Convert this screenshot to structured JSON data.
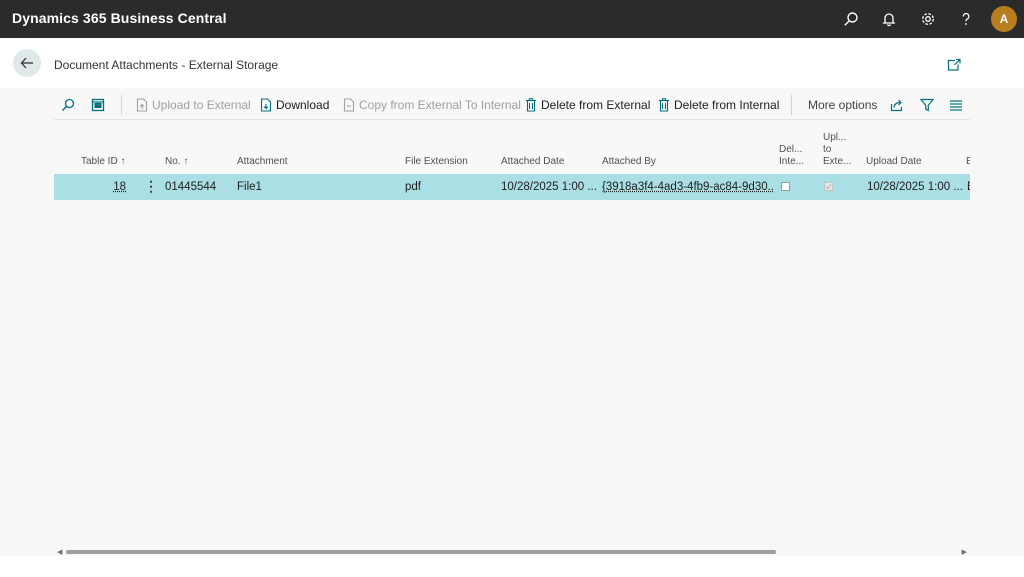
{
  "app": {
    "title": "Dynamics 365 Business Central",
    "user_initial": "A"
  },
  "topbar_icons": [
    "search-icon",
    "bell-icon",
    "gear-icon",
    "help-icon"
  ],
  "page": {
    "title": "Document Attachments - External Storage"
  },
  "actions": {
    "upload": "Upload to External",
    "download": "Download",
    "copy": "Copy from External To Internal",
    "delete_external": "Delete from External",
    "delete_internal": "Delete from Internal",
    "more": "More options"
  },
  "columns": {
    "table_id": "Table ID ↑",
    "no": "No. ↑",
    "attachment": "Attachment",
    "file_extension": "File Extension",
    "attached_date": "Attached Date",
    "attached_by": "Attached By",
    "deleted_internal": [
      "Del...",
      "Inte..."
    ],
    "uploaded_external": [
      "Upl...",
      "to",
      "Exte..."
    ],
    "upload_date": "Upload Date",
    "next_col": "E"
  },
  "rows": [
    {
      "table_id": "18",
      "no": "01445544",
      "attachment": "File1",
      "file_extension": "pdf",
      "attached_date": "10/28/2025 1:00 ...",
      "attached_by": "{3918a3f4-4ad3-4fb9-ac84-9d30...",
      "deleted_internal": false,
      "uploaded_external": true,
      "upload_date": "10/28/2025 1:00 ...",
      "next_col": "E"
    }
  ],
  "colors": {
    "topbar": "#2b2b2b",
    "selected_row": "#a9dfe5",
    "accent": "#00717a",
    "avatar": "#b87d1e"
  }
}
